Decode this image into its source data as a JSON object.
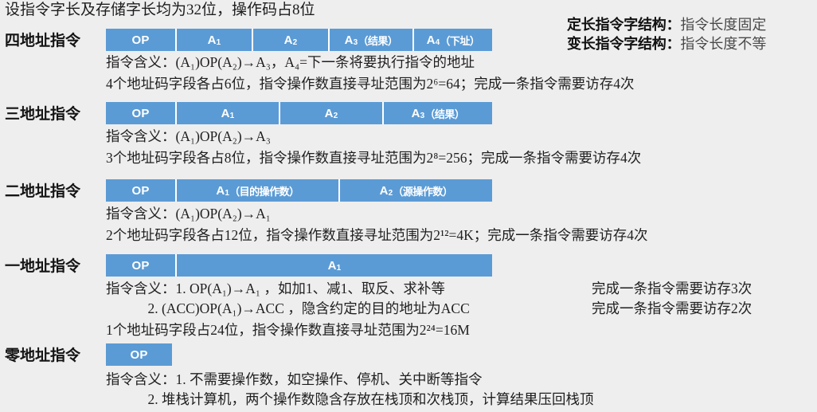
{
  "premise": "设指令字长及存储字长均为32位，操作码占8位",
  "definitions": [
    {
      "term": "定长指令字结构：",
      "desc": "指令长度固定"
    },
    {
      "term": "变长指令字结构：",
      "desc": "指令长度不等"
    }
  ],
  "rows": [
    {
      "label": "四地址指令",
      "cells": [
        {
          "main": "OP",
          "sub": "",
          "paren": ""
        },
        {
          "main": "A",
          "sub": "1",
          "paren": ""
        },
        {
          "main": "A",
          "sub": "2",
          "paren": ""
        },
        {
          "main": "A",
          "sub": "3",
          "paren": "（结果）"
        },
        {
          "main": "A",
          "sub": "4",
          "paren": "（下址）"
        }
      ],
      "lines": [
        "指令含义：(A₁)OP(A₂)→A₃，A₄=下一条将要执行指令的地址",
        "4个地址码字段各占6位，指令操作数直接寻址范围为2⁶=64；完成一条指令需要访存4次"
      ]
    },
    {
      "label": "三地址指令",
      "cells": [
        {
          "main": "OP",
          "sub": "",
          "paren": ""
        },
        {
          "main": "A",
          "sub": "1",
          "paren": ""
        },
        {
          "main": "A",
          "sub": "2",
          "paren": ""
        },
        {
          "main": "A",
          "sub": "3",
          "paren": "（结果）"
        }
      ],
      "lines": [
        "指令含义：(A₁)OP(A₂)→A₃",
        "3个地址码字段各占8位，指令操作数直接寻址范围为2⁸=256；完成一条指令需要访存4次"
      ]
    },
    {
      "label": "二地址指令",
      "cells": [
        {
          "main": "OP",
          "sub": "",
          "paren": ""
        },
        {
          "main": "A",
          "sub": "1",
          "paren": "（目的操作数）"
        },
        {
          "main": "A",
          "sub": "2",
          "paren": "（源操作数）"
        }
      ],
      "lines": [
        "指令含义：(A₁)OP(A₂)→A₁",
        "2个地址码字段各占12位，指令操作数直接寻址范围为2¹²=4K；完成一条指令需要访存4次"
      ]
    },
    {
      "label": "一地址指令",
      "cells": [
        {
          "main": "OP",
          "sub": "",
          "paren": ""
        },
        {
          "main": "A",
          "sub": "1",
          "paren": ""
        }
      ],
      "lines": [
        "指令含义：1. OP(A₁)→A₁ ，如加1、减1、取反、求补等",
        "            2. (ACC)OP(A₁)→ACC ，隐含约定的目的地址为ACC",
        "1个地址码字段占24位，指令操作数直接寻址范围为2²⁴=16M"
      ],
      "side_notes": [
        "完成一条指令需要访存3次",
        "完成一条指令需要访存2次"
      ]
    },
    {
      "label": "零地址指令",
      "cells": [
        {
          "main": "OP",
          "sub": "",
          "paren": ""
        }
      ],
      "lines": [
        "指令含义：1. 不需要操作数，如空操作、停机、关中断等指令",
        "            2. 堆栈计算机，两个操作数隐含存放在栈顶和次栈顶，计算结果压回栈顶"
      ]
    }
  ],
  "colors": {
    "background": "#eeeeee",
    "bar": "#5b9bd5",
    "divider": "#ffffff",
    "text": "#1f1f1f"
  }
}
